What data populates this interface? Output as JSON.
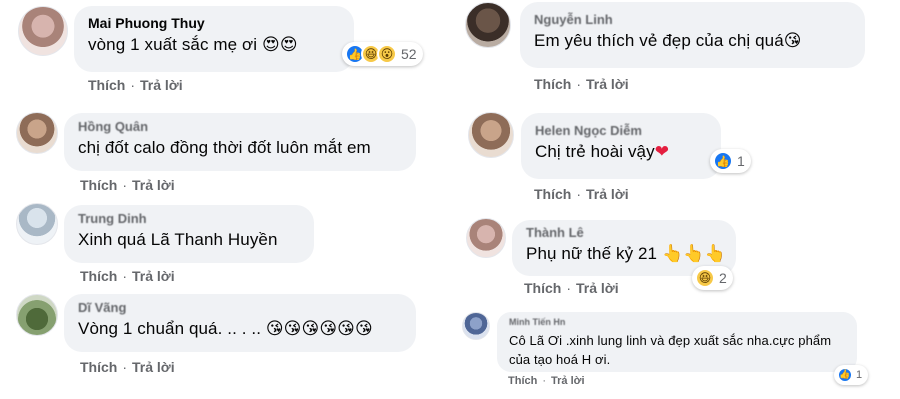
{
  "actions": {
    "like": "Thích",
    "reply": "Trả lời",
    "separator": "·"
  },
  "comments": [
    {
      "name": "Mai Phuong Thuy",
      "text": "vòng 1 xuất sắc mẹ ơi",
      "emoji": "😍😍",
      "reaction_count": "52",
      "reaction_icons": [
        "like-icon",
        "haha-icon",
        "wow-icon"
      ]
    },
    {
      "name": "Hồng Quân",
      "text": "chị đốt calo đồng thời đốt luôn mắt em"
    },
    {
      "name": "Trung Dinh",
      "text": "Xinh quá Lã Thanh Huyền"
    },
    {
      "name": "Dĩ Vãng",
      "text": "Vòng 1 chuẩn quá. .. . ..",
      "emoji": "😘😘😘😘😘😘"
    },
    {
      "name": "Nguyễn Linh",
      "text": "Em yêu thích vẻ đẹp của chị quá",
      "emoji": "😘"
    },
    {
      "name": "Helen Ngọc Diễm",
      "text": "Chị trẻ hoài vậy",
      "emoji": "❤",
      "reaction_count": "1",
      "reaction_icons": [
        "like-icon"
      ]
    },
    {
      "name": "Thành Lê",
      "text": "Phụ nữ thế kỷ 21",
      "emoji": "👆👆👆",
      "reaction_count": "2",
      "reaction_icons": [
        "haha-icon"
      ]
    },
    {
      "name": "Minh Tiến Hn",
      "text": "Cô Lã Ơi .xinh lung linh và đẹp xuất sắc nha.cực phẩm của tạo hoá H ơi.",
      "reaction_count": "1",
      "reaction_icons": [
        "like-icon"
      ]
    }
  ],
  "colors": {
    "bubble": "#f0f2f5",
    "action_text": "#65676b",
    "like_blue": "#1877f2",
    "emoji_yellow": "#f7c948"
  }
}
